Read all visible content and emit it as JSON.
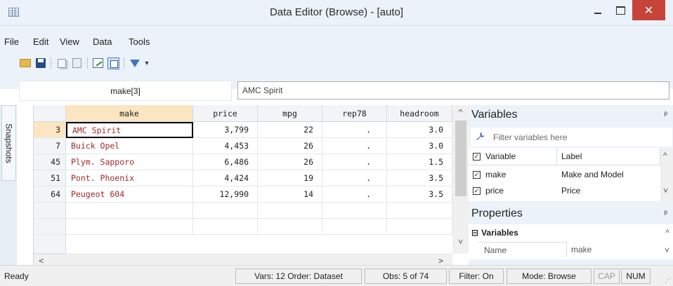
{
  "window": {
    "title": "Data Editor (Browse) - [auto]",
    "minimize": "—",
    "maximize": "□",
    "close": "✕"
  },
  "menu": [
    "File",
    "Edit",
    "View",
    "Data",
    "Tools"
  ],
  "toolbar": {
    "icons": [
      "open-icon",
      "save-icon",
      "copy-icon",
      "paste-icon",
      "edit-mode-icon",
      "browse-mode-icon",
      "filter-icon",
      "dropdown-icon"
    ],
    "dropdown_glyph": "▾"
  },
  "cell_ref": "make[3]",
  "cell_value": "AMC Spirit",
  "snapshots_tab": "Snapshots",
  "grid": {
    "columns": [
      "make",
      "price",
      "mpg",
      "rep78",
      "headroom"
    ],
    "rows": [
      {
        "num": "3",
        "make": "AMC Spirit",
        "price": "3,799",
        "mpg": "22",
        "rep78": ".",
        "headroom": "3.0"
      },
      {
        "num": "7",
        "make": "Buick Opel",
        "price": "4,453",
        "mpg": "26",
        "rep78": ".",
        "headroom": "3.0"
      },
      {
        "num": "45",
        "make": "Plym. Sapporo",
        "price": "6,486",
        "mpg": "26",
        "rep78": ".",
        "headroom": "1.5"
      },
      {
        "num": "51",
        "make": "Pont. Phoenix",
        "price": "4,424",
        "mpg": "19",
        "rep78": ".",
        "headroom": "3.5"
      },
      {
        "num": "64",
        "make": "Peugeot 604",
        "price": "12,990",
        "mpg": "14",
        "rep78": ".",
        "headroom": "3.5"
      }
    ],
    "scroll_up": "^",
    "scroll_down": "˅",
    "scroll_left": "<",
    "scroll_right": ">"
  },
  "variables_panel": {
    "title": "Variables",
    "pin": "ᵖ",
    "filter_placeholder": "Filter variables here",
    "col_variable": "Variable",
    "col_label": "Label",
    "rows": [
      {
        "name": "make",
        "label": "Make and Model"
      },
      {
        "name": "price",
        "label": "Price"
      }
    ]
  },
  "properties_panel": {
    "title": "Properties",
    "pin": "ᵖ",
    "section": "Variables",
    "section_toggle": "⊟",
    "row_name": "Name",
    "row_value": "make"
  },
  "status": {
    "ready": "Ready",
    "vars": "Vars: 12  Order: Dataset",
    "obs": "Obs: 5 of 74",
    "filter": "Filter: On",
    "mode": "Mode: Browse",
    "cap": "CAP",
    "num": "NUM"
  }
}
